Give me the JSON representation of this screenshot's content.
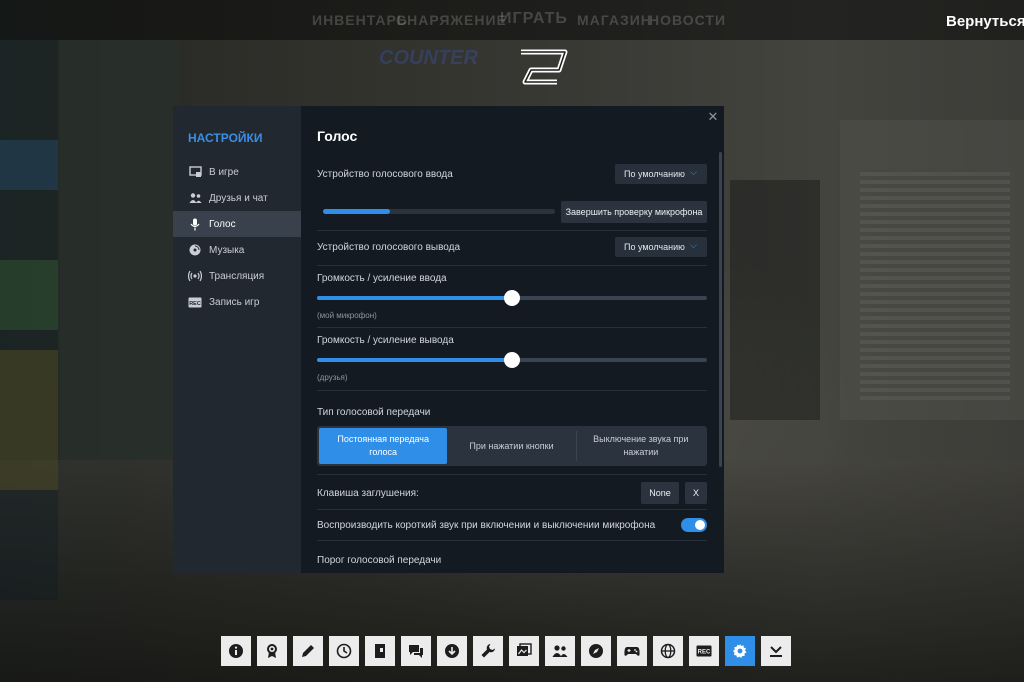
{
  "background": {
    "nav_items": [
      "ИНВЕНТАРЬ",
      "СНАРЯЖЕНИЕ",
      "ИГРАТЬ",
      "МАГАЗИН",
      "НОВОСТИ"
    ],
    "logo_text": "COUNTER 2",
    "return_label": "Вернуться"
  },
  "sidebar": {
    "title": "НАСТРОЙКИ",
    "items": [
      {
        "label": "В игре",
        "icon": "game-window-icon"
      },
      {
        "label": "Друзья и чат",
        "icon": "friends-icon"
      },
      {
        "label": "Голос",
        "icon": "microphone-icon",
        "active": true
      },
      {
        "label": "Музыка",
        "icon": "music-disc-icon"
      },
      {
        "label": "Трансляция",
        "icon": "broadcast-icon"
      },
      {
        "label": "Запись игр",
        "icon": "rec-icon"
      }
    ]
  },
  "voice": {
    "title": "Голос",
    "input_device_label": "Устройство голосового ввода",
    "input_device_value": "По умолчанию",
    "mic_level": 0.29,
    "mic_test_button": "Завершить проверку микрофона",
    "output_device_label": "Устройство голосового вывода",
    "output_device_value": "По умолчанию",
    "input_volume_label": "Громкость / усиление ввода",
    "input_volume_sublabel": "(мой микрофон)",
    "input_volume": 0.5,
    "output_volume_label": "Громкость / усиление вывода",
    "output_volume_sublabel": "(друзья)",
    "output_volume": 0.5,
    "transmission_label": "Тип голосовой передачи",
    "transmission_options": [
      "Постоянная передача голоса",
      "При нажатии кнопки",
      "Выключение звука при нажатии"
    ],
    "transmission_selected": 0,
    "mute_key_label": "Клавиша заглушения:",
    "mute_key_value": "None",
    "mute_key_clear": "X",
    "beep_label": "Воспроизводить короткий звук при включении и выключении микрофона",
    "beep_enabled": true,
    "threshold_label": "Порог голосовой передачи"
  },
  "toolbar": {
    "buttons": [
      "info-icon",
      "achievements-icon",
      "pencil-icon",
      "clock-icon",
      "notebook-icon",
      "chat-icon",
      "download-icon",
      "wrench-icon",
      "screenshot-icon",
      "friends-icon",
      "compass-icon",
      "gamepad-icon",
      "globe-icon",
      "rec-icon",
      "settings-gear-icon",
      "minimize-icon"
    ],
    "active_index": 14
  },
  "colors": {
    "accent": "#2f8fe8",
    "panel": "#131a22",
    "sidebar": "#222830",
    "sidebar_active": "#38414c"
  }
}
